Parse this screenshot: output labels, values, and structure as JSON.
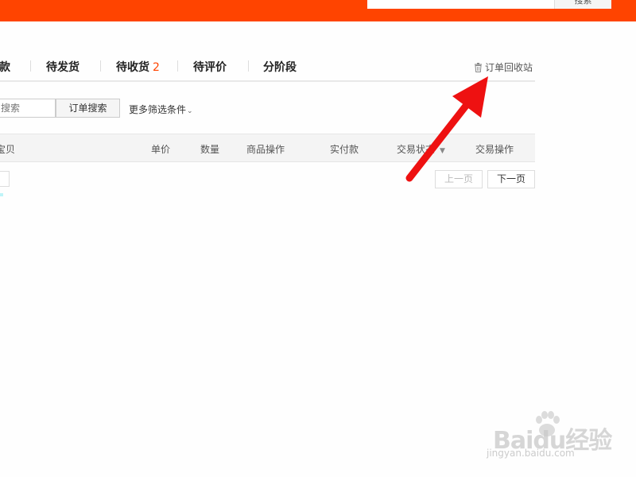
{
  "header": {
    "search_button_label": "搜索"
  },
  "tabs": [
    {
      "label": "款"
    },
    {
      "label": "待发货"
    },
    {
      "label": "待收货",
      "count": "2"
    },
    {
      "label": "待评价"
    },
    {
      "label": "分阶段"
    }
  ],
  "recycle_bin": {
    "label": "订单回收站",
    "icon": "trash-icon"
  },
  "search": {
    "placeholder": "搜索",
    "button_label": "订单搜索",
    "more_filters_label": "更多筛选条件",
    "more_filters_icon": "chevron-down-icon"
  },
  "table": {
    "columns": [
      "宝贝",
      "单价",
      "数量",
      "商品操作",
      "实付款",
      "交易状态",
      "交易操作"
    ]
  },
  "pager": {
    "prev_label": "上一页",
    "next_label": "下一页"
  },
  "watermark": {
    "logo_text": "Baidu经验",
    "url_text": "jingyan.baidu.com"
  },
  "colors": {
    "brand": "#ff4400",
    "annotation_arrow": "#ee1111"
  }
}
